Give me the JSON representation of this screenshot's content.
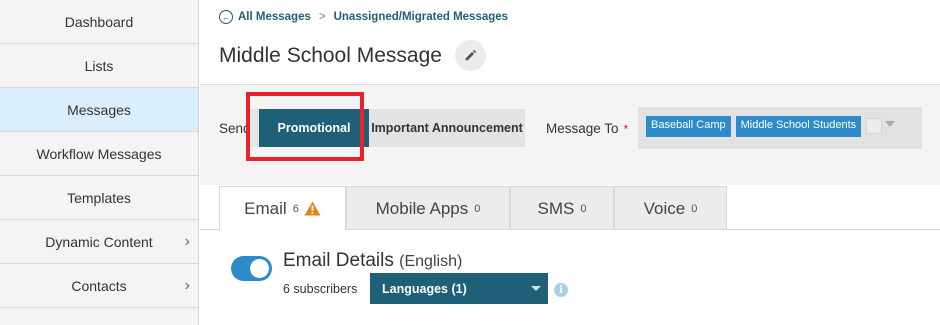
{
  "sidebar": {
    "items": [
      {
        "label": "Dashboard",
        "active": false,
        "has_chevron": false
      },
      {
        "label": "Lists",
        "active": false,
        "has_chevron": false
      },
      {
        "label": "Messages",
        "active": true,
        "has_chevron": false
      },
      {
        "label": "Workflow Messages",
        "active": false,
        "has_chevron": false
      },
      {
        "label": "Templates",
        "active": false,
        "has_chevron": false
      },
      {
        "label": "Dynamic Content",
        "active": false,
        "has_chevron": true
      },
      {
        "label": "Contacts",
        "active": false,
        "has_chevron": true
      }
    ]
  },
  "breadcrumb": {
    "back_icon": "arrow-left-circle-icon",
    "all_messages": "All Messages",
    "separator": ">",
    "current": "Unassigned/Migrated Messages"
  },
  "page": {
    "title": "Middle School Message",
    "edit_icon": "pencil-icon"
  },
  "send_as": {
    "label": "Send",
    "options": [
      "Promotional",
      "Important Announcement"
    ],
    "selected": "Promotional"
  },
  "message_to": {
    "label": "Message To",
    "required_mark": "*",
    "recipients": [
      "Baseball Camp",
      "Middle School Students"
    ]
  },
  "tabs": [
    {
      "label": "Email",
      "count": "6",
      "warning": true,
      "active": true
    },
    {
      "label": "Mobile Apps",
      "count": "0",
      "warning": false,
      "active": false
    },
    {
      "label": "SMS",
      "count": "0",
      "warning": false,
      "active": false
    },
    {
      "label": "Voice",
      "count": "0",
      "warning": false,
      "active": false
    }
  ],
  "email_details": {
    "enabled": true,
    "title": "Email Details",
    "language_note": "(English)",
    "subscribers": "6 subscribers",
    "languages_select": "Languages (1)",
    "info_icon": "info-icon"
  },
  "colors": {
    "primary": "#1f5f78",
    "accent_blue": "#2e8bc9",
    "active_sidebar": "#dbeefb",
    "highlight_red": "#e8212c",
    "warning_orange": "#e8821e"
  }
}
